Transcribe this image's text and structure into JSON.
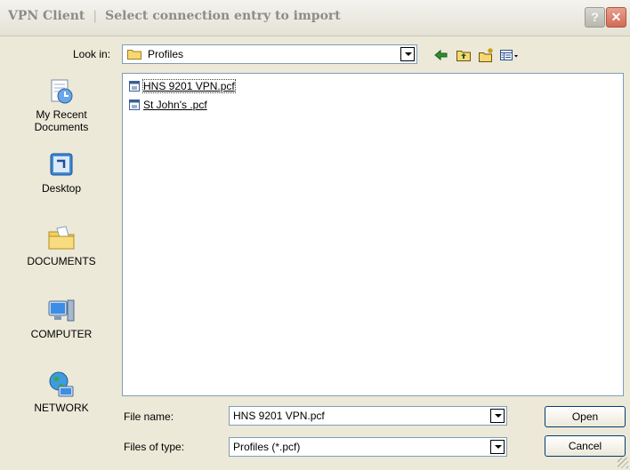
{
  "window": {
    "app_name": "VPN Client",
    "title_separator": "|",
    "dialog_title": "Select connection entry to import"
  },
  "title_buttons": {
    "help": "?",
    "close": "✕"
  },
  "look_in": {
    "label": "Look in:",
    "value": "Profiles"
  },
  "toolbar": {
    "back_icon": "back-arrow-icon",
    "up_icon": "up-folder-icon",
    "new_folder_icon": "new-folder-icon",
    "views_icon": "views-menu-icon"
  },
  "places": [
    {
      "label": "My Recent\nDocuments",
      "icon": "recent-documents-icon"
    },
    {
      "label": "Desktop",
      "icon": "desktop-icon"
    },
    {
      "label": "DOCUMENTS",
      "icon": "documents-folder-icon"
    },
    {
      "label": "COMPUTER",
      "icon": "computer-icon"
    },
    {
      "label": "NETWORK",
      "icon": "network-globe-icon"
    }
  ],
  "files": [
    {
      "name": "HNS 9201 VPN.pcf",
      "selected": true
    },
    {
      "name": "St John's .pcf",
      "selected": false
    }
  ],
  "file_name": {
    "label": "File name:",
    "value": "HNS 9201 VPN.pcf"
  },
  "file_type": {
    "label": "Files of type:",
    "value": "Profiles (*.pcf)"
  },
  "buttons": {
    "open": "Open",
    "cancel": "Cancel"
  }
}
